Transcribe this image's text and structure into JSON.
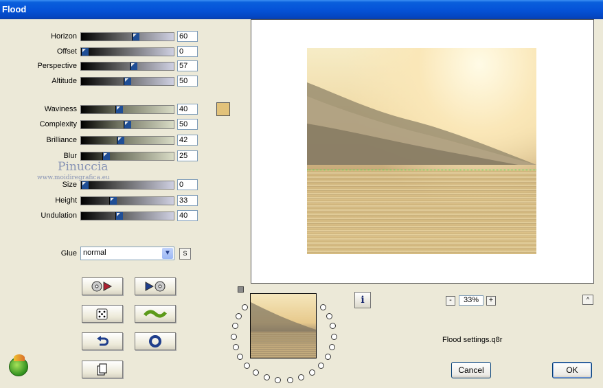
{
  "window": {
    "title": "Flood"
  },
  "params": [
    {
      "id": "horizon",
      "label": "Horizon",
      "value": "60",
      "pos": 0.6,
      "track": "gray"
    },
    {
      "id": "offset",
      "label": "Offset",
      "value": "0",
      "pos": 0.0,
      "track": "gray"
    },
    {
      "id": "perspective",
      "label": "Perspective",
      "value": "57",
      "pos": 0.57,
      "track": "gray"
    },
    {
      "id": "altitude",
      "label": "Altitude",
      "value": "50",
      "pos": 0.5,
      "track": "gray"
    },
    {
      "id": "waviness",
      "label": "Waviness",
      "value": "40",
      "pos": 0.4,
      "track": "green"
    },
    {
      "id": "complexity",
      "label": "Complexity",
      "value": "50",
      "pos": 0.5,
      "track": "green"
    },
    {
      "id": "brilliance",
      "label": "Brilliance",
      "value": "42",
      "pos": 0.42,
      "track": "green"
    },
    {
      "id": "blur",
      "label": "Blur",
      "value": "25",
      "pos": 0.25,
      "track": "green"
    },
    {
      "id": "size",
      "label": "Size",
      "value": "0",
      "pos": 0.0,
      "track": "gray"
    },
    {
      "id": "height",
      "label": "Height",
      "value": "33",
      "pos": 0.33,
      "track": "gray"
    },
    {
      "id": "undulation",
      "label": "Undulation",
      "value": "40",
      "pos": 0.4,
      "track": "gray"
    }
  ],
  "colors": {
    "flood_color": "#e2c27a",
    "title_bar": "#0553d8"
  },
  "glue": {
    "label": "Glue",
    "selected": "normal"
  },
  "buttons": {
    "s_label": "S",
    "zoom_minus": "-",
    "zoom_plus": "+",
    "zoom_value": "33%",
    "up": "^",
    "cancel": "Cancel",
    "ok": "OK"
  },
  "tool_icons": [
    "open-preset-icon",
    "save-preset-icon",
    "randomize-dice-icon",
    "wave-icon",
    "reset-icon",
    "stop-icon",
    "copy-icon"
  ],
  "info_icon": "i",
  "settings_file": "Flood settings.q8r",
  "watermark": {
    "line1": "Pinuccia",
    "line2": "www.moidiregrafica.eu"
  }
}
